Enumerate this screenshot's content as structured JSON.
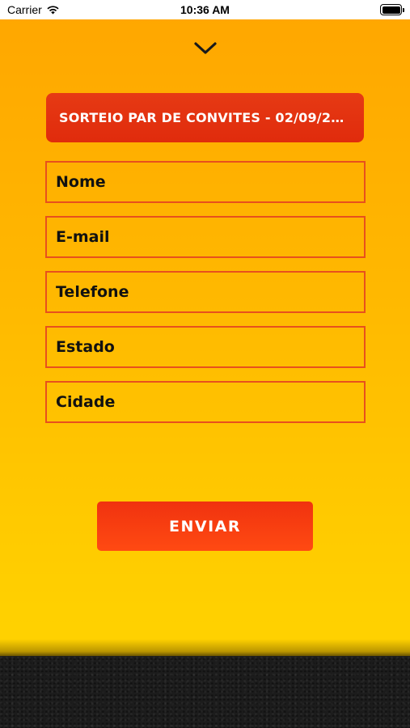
{
  "status_bar": {
    "carrier": "Carrier",
    "time": "10:36 AM",
    "wifi_icon": "wifi-icon",
    "battery_level": 1.0
  },
  "header": {
    "collapse_icon": "chevron-down-icon"
  },
  "raffle": {
    "label": "SORTEIO PAR DE CONVITES - 02/09/202..."
  },
  "form": {
    "fields": [
      {
        "placeholder": "Nome",
        "value": ""
      },
      {
        "placeholder": "E-mail",
        "value": ""
      },
      {
        "placeholder": "Telefone",
        "value": ""
      },
      {
        "placeholder": "Estado",
        "value": ""
      },
      {
        "placeholder": "Cidade",
        "value": ""
      }
    ],
    "submit_label": "ENVIAR"
  },
  "colors": {
    "background_top": "#ffa600",
    "background_bottom": "#ffd100",
    "accent_red": "#e02b0c",
    "field_border": "#e8501d",
    "footer": "#1c1c1c"
  }
}
